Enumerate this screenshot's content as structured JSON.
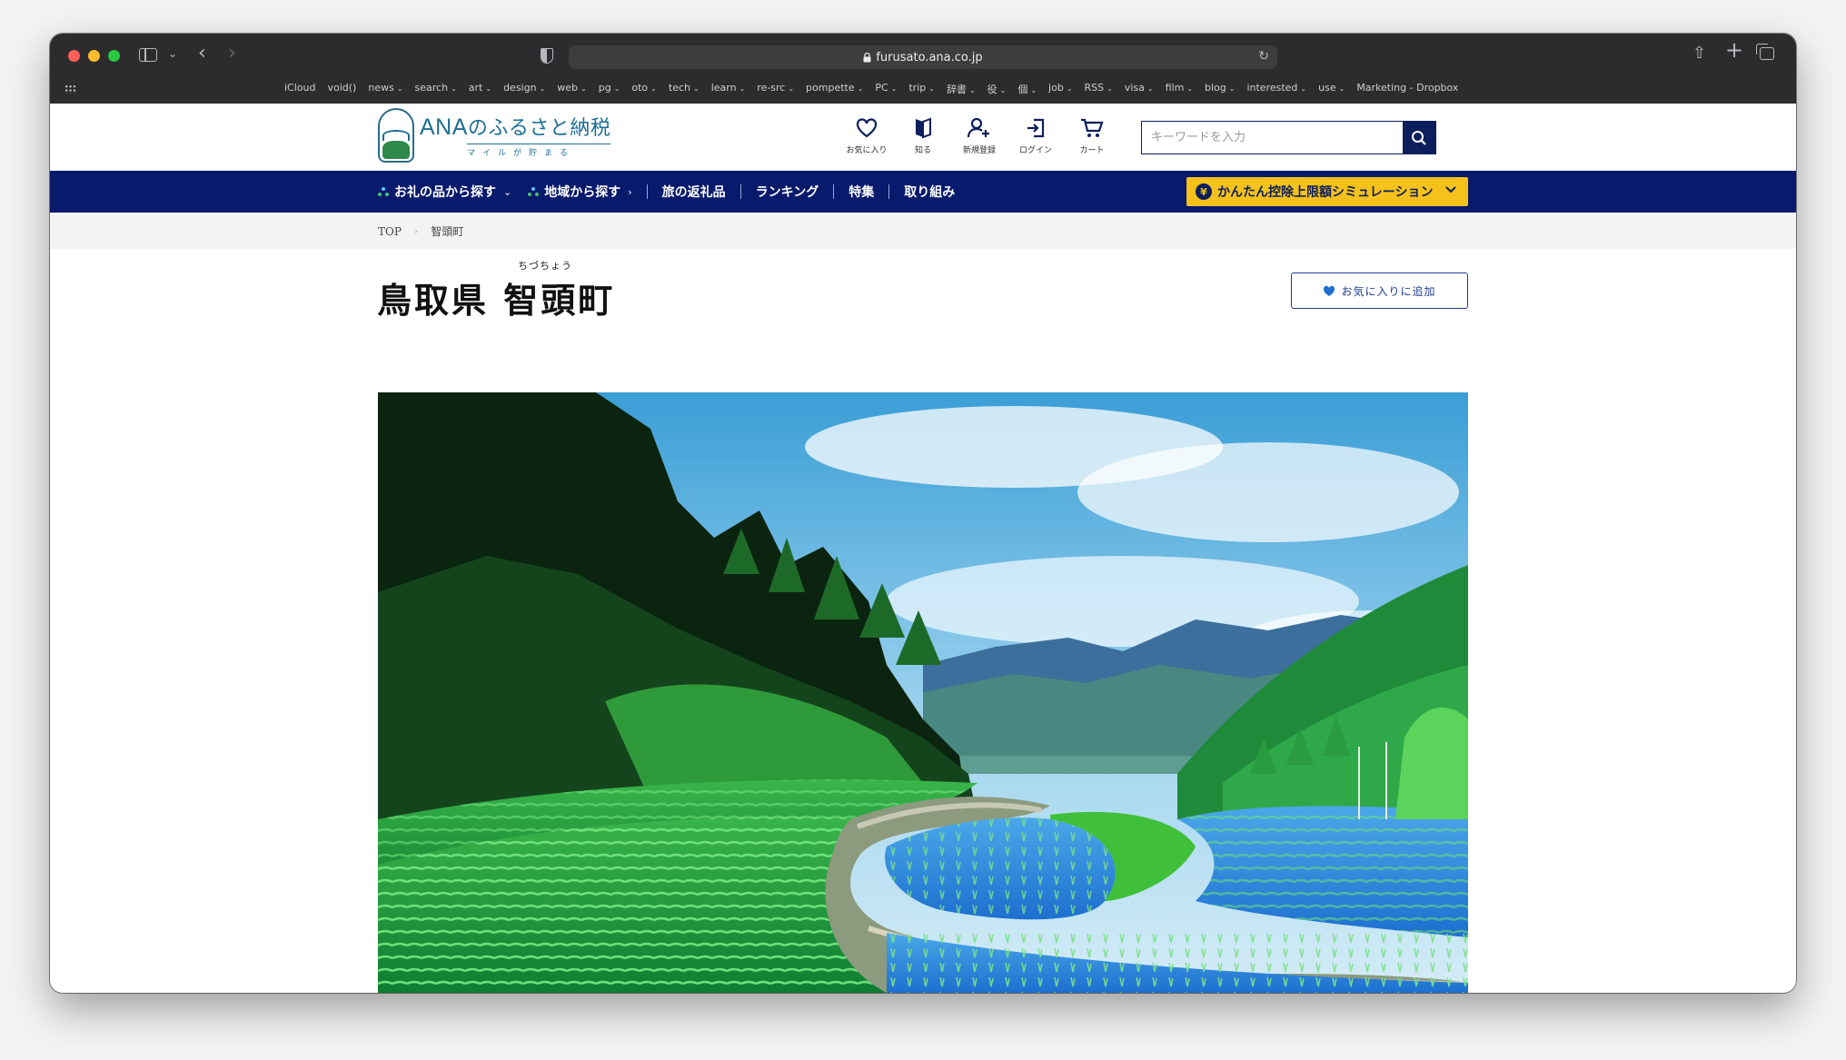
{
  "browser": {
    "url": "furusato.ana.co.jp",
    "bookmarks": [
      {
        "label": "iCloud",
        "menu": false
      },
      {
        "label": "void()",
        "menu": false
      },
      {
        "label": "news",
        "menu": true
      },
      {
        "label": "search",
        "menu": true
      },
      {
        "label": "art",
        "menu": true
      },
      {
        "label": "design",
        "menu": true
      },
      {
        "label": "web",
        "menu": true
      },
      {
        "label": "pg",
        "menu": true
      },
      {
        "label": "oto",
        "menu": true
      },
      {
        "label": "tech",
        "menu": true
      },
      {
        "label": "learn",
        "menu": true
      },
      {
        "label": "re-src",
        "menu": true
      },
      {
        "label": "pompette",
        "menu": true
      },
      {
        "label": "PC",
        "menu": true
      },
      {
        "label": "trip",
        "menu": true
      },
      {
        "label": "辞書",
        "menu": true
      },
      {
        "label": "役",
        "menu": true
      },
      {
        "label": "個",
        "menu": true
      },
      {
        "label": "job",
        "menu": true
      },
      {
        "label": "RSS",
        "menu": true
      },
      {
        "label": "visa",
        "menu": true
      },
      {
        "label": "film",
        "menu": true
      },
      {
        "label": "blog",
        "menu": true
      },
      {
        "label": "interested",
        "menu": true
      },
      {
        "label": "use",
        "menu": true
      },
      {
        "label": "Marketing - Dropbox",
        "menu": false
      }
    ]
  },
  "header": {
    "logo_title_latin": "ANA",
    "logo_title_jp": "のふるさと納税",
    "logo_subtitle": "マイルが貯まる",
    "icons": [
      {
        "name": "favorites",
        "label": "お気に入り"
      },
      {
        "name": "learn",
        "label": "知る"
      },
      {
        "name": "register",
        "label": "新規登録"
      },
      {
        "name": "login",
        "label": "ログイン"
      },
      {
        "name": "cart",
        "label": "カート"
      }
    ],
    "search_placeholder": "キーワードを入力"
  },
  "nav": {
    "items": [
      {
        "label": "お礼の品から探す",
        "chevron": "⌄"
      },
      {
        "label": "地域から探す",
        "chevron": "›"
      },
      {
        "label": "旅の返礼品"
      },
      {
        "label": "ランキング"
      },
      {
        "label": "特集"
      },
      {
        "label": "取り組み"
      }
    ],
    "simulation_label": "かんたん控除上限額シミュレーション",
    "yen_symbol": "¥"
  },
  "breadcrumb": {
    "home": "TOP",
    "current": "智頭町"
  },
  "main": {
    "title_ruby": "ちづちょう",
    "title": "鳥取県 智頭町",
    "favorite_button": "お気に入りに追加"
  },
  "colors": {
    "navy": "#071a6b",
    "accent_yellow": "#f6c11a",
    "logo_blue": "#1e6f94"
  }
}
